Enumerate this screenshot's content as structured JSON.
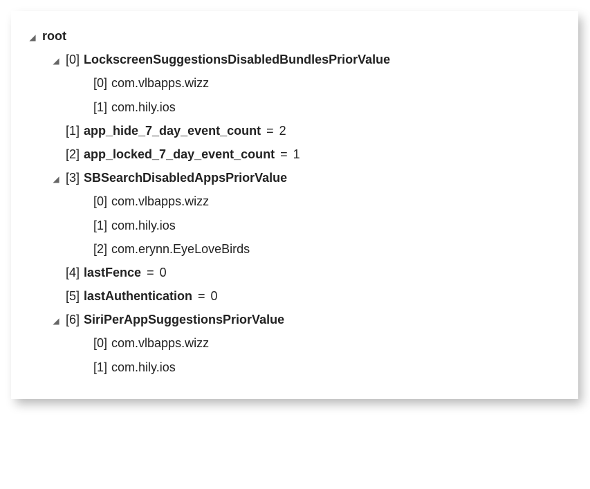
{
  "tree": {
    "root_label": "root",
    "children": [
      {
        "idx": "[0]",
        "key": "LockscreenSuggestionsDisabledBundlesPriorValue",
        "expanded": true,
        "items": [
          {
            "idx": "[0]",
            "val": "com.vlbapps.wizz"
          },
          {
            "idx": "[1]",
            "val": "com.hily.ios"
          }
        ]
      },
      {
        "idx": "[1]",
        "key": "app_hide_7_day_event_count",
        "value": "2"
      },
      {
        "idx": "[2]",
        "key": "app_locked_7_day_event_count",
        "value": "1"
      },
      {
        "idx": "[3]",
        "key": "SBSearchDisabledAppsPriorValue",
        "expanded": true,
        "items": [
          {
            "idx": "[0]",
            "val": "com.vlbapps.wizz"
          },
          {
            "idx": "[1]",
            "val": "com.hily.ios"
          },
          {
            "idx": "[2]",
            "val": "com.erynn.EyeLoveBirds"
          }
        ]
      },
      {
        "idx": "[4]",
        "key": "lastFence",
        "value": "0"
      },
      {
        "idx": "[5]",
        "key": "lastAuthentication",
        "value": "0"
      },
      {
        "idx": "[6]",
        "key": "SiriPerAppSuggestionsPriorValue",
        "expanded": true,
        "items": [
          {
            "idx": "[0]",
            "val": "com.vlbapps.wizz"
          },
          {
            "idx": "[1]",
            "val": "com.hily.ios"
          }
        ]
      }
    ]
  },
  "glyphs": {
    "expanded": "◢"
  }
}
